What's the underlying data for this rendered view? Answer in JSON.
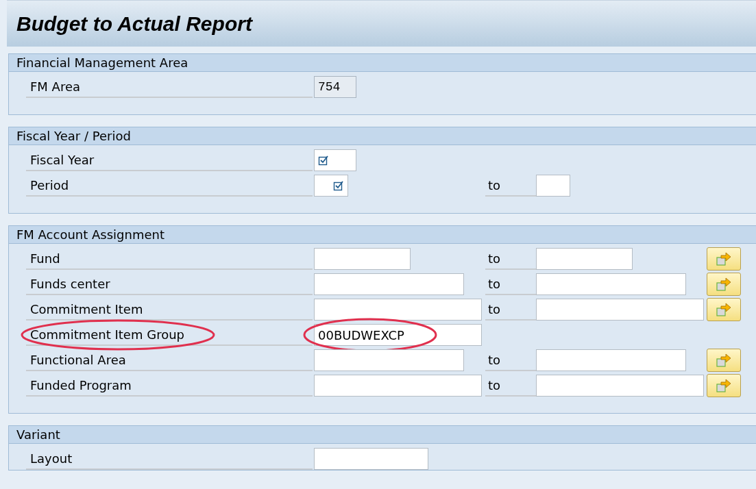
{
  "title": "Budget to Actual Report",
  "sections": [
    {
      "title": "Financial Management Area",
      "rows": [
        {
          "label": "FM Area",
          "value": "754",
          "readonly": true
        }
      ]
    },
    {
      "title": "Fiscal Year / Period",
      "rows": [
        {
          "label": "Fiscal Year",
          "required": true
        },
        {
          "label": "Period",
          "required": true,
          "to_label": "to",
          "range": true
        }
      ]
    },
    {
      "title": "FM Account Assignment",
      "rows": [
        {
          "label": "Fund",
          "to_label": "to",
          "range": true,
          "multiple": true
        },
        {
          "label": "Funds center",
          "to_label": "to",
          "range": true,
          "multiple": true
        },
        {
          "label": "Commitment Item",
          "to_label": "to",
          "range": true,
          "multiple": true
        },
        {
          "label": "Commitment Item Group",
          "value": "00BUDWEXCP",
          "highlighted": true
        },
        {
          "label": "Functional Area",
          "to_label": "to",
          "range": true,
          "multiple": true
        },
        {
          "label": "Funded Program",
          "to_label": "to",
          "range": true,
          "multiple": true
        }
      ]
    },
    {
      "title": "Variant",
      "rows": [
        {
          "label": "Layout"
        }
      ]
    }
  ]
}
